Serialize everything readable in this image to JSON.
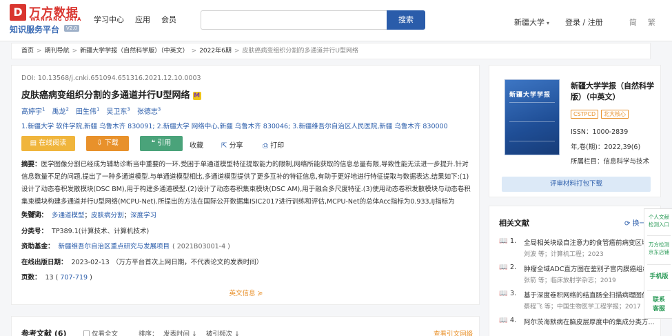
{
  "header": {
    "logo_mark": "D",
    "logo_cn": "万方数据",
    "logo_en": "WANFANG DATA",
    "logo_sub": "知识服务平台",
    "logo_ver": "V2.0",
    "nav": [
      "学习中心",
      "应用",
      "会员"
    ],
    "search_placeholder": "",
    "search_button": "搜索",
    "institution": "新疆大学",
    "login": "登录 / 注册",
    "lang_simplified": "简",
    "lang_traditional": "繁"
  },
  "breadcrumb": {
    "items": [
      "首页",
      "期刊导航",
      "新疆大学学报（自然科学版）（中英文）",
      "2022年6期"
    ],
    "separator": ">",
    "current": "皮肤癌病变组织分割的多通道并行U型网络"
  },
  "article": {
    "doi": "DOI: 10.13568/j.cnki.651094.651316.2021.12.10.0003",
    "title": "皮肤癌病变组织分割的多通道并行U型网络",
    "badge": "M",
    "authors": [
      {
        "name": "高婷宇",
        "sup": "1"
      },
      {
        "name": "禹龙",
        "sup": "2"
      },
      {
        "name": "田生伟",
        "sup": "1"
      },
      {
        "name": "吴卫东",
        "sup": "3"
      },
      {
        "name": "张德志",
        "sup": "3"
      }
    ],
    "affiliations": "1.新疆大学 软件学院,新疆 乌鲁木齐 830091; 2.新疆大学 网络中心,新疆 乌鲁木齐 830046; 3.新疆维吾尔自治区人民医院,新疆 乌鲁木齐 830000",
    "actions": {
      "read": "在线阅读",
      "download": "下载",
      "cite": "引用",
      "favorite": "收藏",
      "share": "分享",
      "print": "打印"
    },
    "abstract_label": "摘要：",
    "abstract": "医学图像分割已经成为辅助诊断当中重要的一环.受困于单通道模型特征提取能力的限制,网络所能获取的信息总量有限,导致性能无法进一步提升.针对信息数量不足的问题,提出了一种多通道模型.与单通道模型相比,多通道模型提供了更多互补的特征信息,有助于更好地进行特征提取与数据表达.结果如下:(1)设计了动态卷积发散模块(DSC BM),用于构建多通道模型.(2)设计了动态卷积集束模块(DSC AM),用于融合多尺度特征.(3)使用动态卷积发散模块与动态卷积集束模块构建多通道并行U型网络(MCPU-Net).所提出的方法在国际公开数据集ISIC2017进行训练和评估,MCPU-Net的总体Acc指标为0.933,IJ指标为0.772.",
    "keywords_label": "关键词：",
    "keywords": [
      "多通道模型",
      "皮肤病分割",
      "深度学习"
    ],
    "keyword_sep": "；",
    "classification_label": "分类号：",
    "classification": "TP389.1(计算技术、计算机技术)",
    "funding_label": "资助基金：",
    "funding": "新疆维吾尔自治区重点研究与发展项目",
    "funding_no": "( 2021B03001-4 )",
    "pubdate_label": "在线出版日期：",
    "pubdate": "2023-02-13",
    "pubdate_note": "（万方平台首次上网日期，不代表论文的发表时间）",
    "pages_label": "页数：",
    "pages": "13",
    "page_range": "707-719",
    "english_info": "英文信息"
  },
  "references": {
    "title": "参考文献 (6)",
    "only_fulltext": "仅看全文",
    "sort_label": "排序：",
    "sort_time": "发表时间",
    "sort_cited": "被引频次",
    "map_link": "查看引文网络"
  },
  "journal": {
    "cover_title": "新疆大学学报",
    "name": "新疆大学学报（自然科学版）（中英文）",
    "tags": [
      "CSTPCD",
      "北大核心"
    ],
    "issn": "ISSN：1000-2839",
    "year_vol": "年,卷(期)：2022,39(6)",
    "column": "所属栏目：信息科学与技术",
    "pack_button": "评审材料打包下载"
  },
  "related": {
    "title": "相关文献",
    "refresh": "换一批",
    "items": [
      {
        "num": "1.",
        "title": "全局相关块级自注意力的食管癌前病变区域...",
        "meta": "刘波 等；计算机工程；2023"
      },
      {
        "num": "2.",
        "title": "肿瘤全域ADC直方图在鉴别子宫内膜癌组织...",
        "meta": "张箭 等；临床放射学杂志；2019"
      },
      {
        "num": "3.",
        "title": "基于深度卷积网络的结直肠全扫描病理图像...",
        "meta": "蔡程飞 等；中国生物医学工程学报；2017"
      },
      {
        "num": "4.",
        "title": "阿尔茨海默病在脑皮层厚度中的集成分类方...",
        "meta": ""
      }
    ]
  },
  "side_panel": {
    "items": [
      "个人文献检测入口",
      "万方检测京东店铺",
      "手机版",
      "联系客服"
    ]
  },
  "colors": {
    "brand_red": "#d9352f",
    "link_blue": "#2a5caa",
    "orange": "#e8912b",
    "green": "#4aa37a"
  }
}
